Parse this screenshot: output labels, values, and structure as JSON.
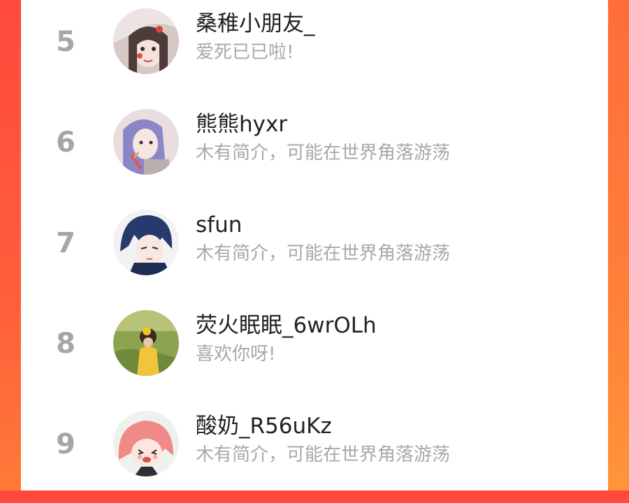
{
  "ranking": {
    "items": [
      {
        "rank": "5",
        "name": "桑稚小朋友_",
        "bio": "爱死已已啦!"
      },
      {
        "rank": "6",
        "name": "熊熊hyxr",
        "bio": "木有简介，可能在世界角落游荡"
      },
      {
        "rank": "7",
        "name": "sfun",
        "bio": "木有简介，可能在世界角落游荡"
      },
      {
        "rank": "8",
        "name": "荧火眠眠_6wrOLh",
        "bio": "喜欢你呀!"
      },
      {
        "rank": "9",
        "name": "酸奶_R56uKz",
        "bio": "木有简介，可能在世界角落游荡"
      }
    ]
  },
  "colors": {
    "accent_left": "#ff4a3d",
    "accent_right": "#ff8a38",
    "rank_gray": "#a6a6a6",
    "name_text": "#222222",
    "bio_text": "#a8a8a8"
  }
}
